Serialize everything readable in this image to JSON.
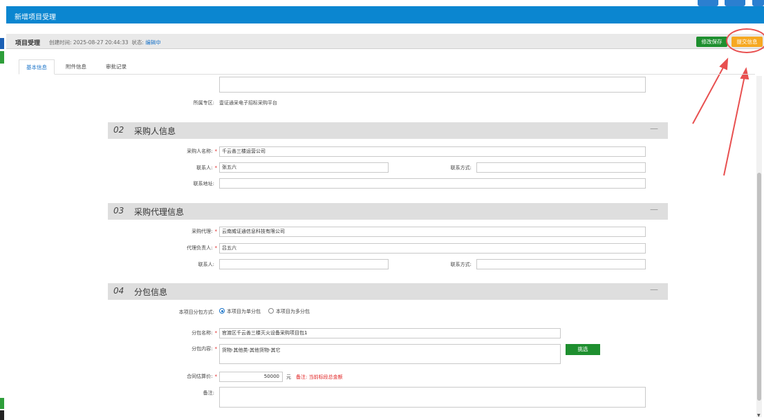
{
  "window": {
    "title": "新增项目受理"
  },
  "header": {
    "title": "项目受理",
    "created_label": "创建时间:",
    "created_value": "2025-08-27 20:44:33",
    "status_label": "状态:",
    "status_value": "编辑中",
    "save_label": "修改保存",
    "submit_label": "提交信息"
  },
  "tabs": [
    {
      "label": "基本信息",
      "active": true
    },
    {
      "label": "附件信息",
      "active": false
    },
    {
      "label": "审批记录",
      "active": false
    }
  ],
  "basic": {
    "zone_label": "所属专区:",
    "zone_value": "壹证通采电子招标采购平台"
  },
  "purchaser": {
    "num": "02",
    "title": "采购人信息",
    "collapse": "—",
    "name_label": "采购人名称:",
    "name_value": "千云善三楼运营公司",
    "contact_label": "联系人:",
    "contact_value": "张五六",
    "phone_label": "联系方式:",
    "phone_value": "",
    "address_label": "联系地址:",
    "address_value": ""
  },
  "agency": {
    "num": "03",
    "title": "采购代理信息",
    "collapse": "—",
    "agent_label": "采购代理:",
    "agent_value": "云南威证通信息科技有限公司",
    "manager_label": "代理负责人:",
    "manager_value": "吕五六",
    "contact_label": "联系人:",
    "contact_value": "",
    "phone_label": "联系方式:",
    "phone_value": ""
  },
  "package": {
    "num": "04",
    "title": "分包信息",
    "collapse": "—",
    "mode_label": "本项目分包方式:",
    "mode_single": "本项目为单分包",
    "mode_multi": "本项目为多分包",
    "pkg_name_label": "分包名称:",
    "pkg_name_value": "官渡区千云善三楼灭火设备采购项目包1",
    "pkg_content_label": "分包内容:",
    "pkg_content_value": "货物-其他类-其他货物-其它",
    "pick_label": "挑选",
    "price_label": "合同估算价:",
    "price_value": "50000",
    "price_unit": "元",
    "price_note_label": "备注:",
    "price_note_value": "当前标段总金额",
    "remark_label": "备注:",
    "remark_value": ""
  },
  "colors": {
    "titlebar": "#0b86d0",
    "save_button": "#1e8f2f",
    "submit_button": "#f6a821",
    "annotation": "#e85050",
    "required": "#e02020"
  }
}
